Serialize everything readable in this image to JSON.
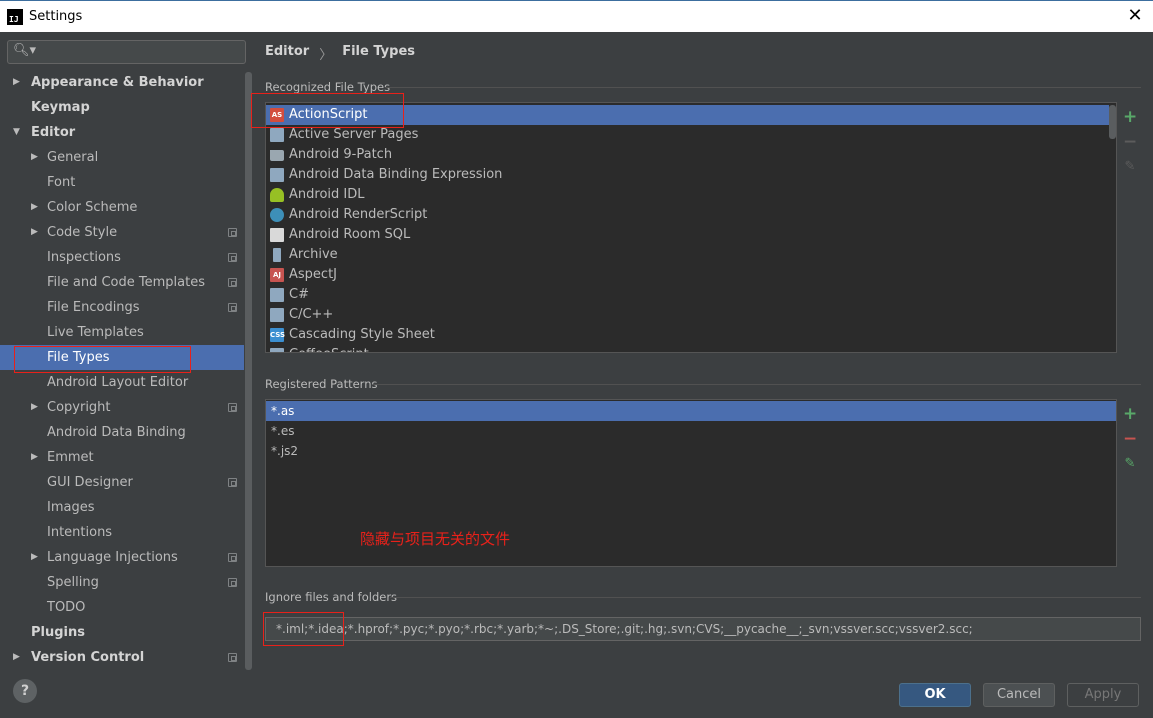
{
  "window": {
    "title": "Settings",
    "app_icon_text": "IJ"
  },
  "search": {
    "placeholder": ""
  },
  "sidebar": {
    "items": [
      {
        "label": "Appearance & Behavior",
        "level": 0,
        "expandable": true,
        "expanded": false,
        "project": false
      },
      {
        "label": "Keymap",
        "level": 0,
        "expandable": false,
        "project": false
      },
      {
        "label": "Editor",
        "level": 0,
        "expandable": true,
        "expanded": true,
        "project": false
      },
      {
        "label": "General",
        "level": 1,
        "expandable": true,
        "expanded": false,
        "project": false
      },
      {
        "label": "Font",
        "level": 1,
        "expandable": false,
        "project": false
      },
      {
        "label": "Color Scheme",
        "level": 1,
        "expandable": true,
        "expanded": false,
        "project": false
      },
      {
        "label": "Code Style",
        "level": 1,
        "expandable": true,
        "expanded": false,
        "project": true
      },
      {
        "label": "Inspections",
        "level": 1,
        "expandable": false,
        "project": true
      },
      {
        "label": "File and Code Templates",
        "level": 1,
        "expandable": false,
        "project": true
      },
      {
        "label": "File Encodings",
        "level": 1,
        "expandable": false,
        "project": true
      },
      {
        "label": "Live Templates",
        "level": 1,
        "expandable": false,
        "project": false
      },
      {
        "label": "File Types",
        "level": 1,
        "expandable": false,
        "project": false,
        "selected": true
      },
      {
        "label": "Android Layout Editor",
        "level": 1,
        "expandable": false,
        "project": false
      },
      {
        "label": "Copyright",
        "level": 1,
        "expandable": true,
        "expanded": false,
        "project": true
      },
      {
        "label": "Android Data Binding",
        "level": 1,
        "expandable": false,
        "project": false
      },
      {
        "label": "Emmet",
        "level": 1,
        "expandable": true,
        "expanded": false,
        "project": false
      },
      {
        "label": "GUI Designer",
        "level": 1,
        "expandable": false,
        "project": true
      },
      {
        "label": "Images",
        "level": 1,
        "expandable": false,
        "project": false
      },
      {
        "label": "Intentions",
        "level": 1,
        "expandable": false,
        "project": false
      },
      {
        "label": "Language Injections",
        "level": 1,
        "expandable": true,
        "expanded": false,
        "project": true
      },
      {
        "label": "Spelling",
        "level": 1,
        "expandable": false,
        "project": true
      },
      {
        "label": "TODO",
        "level": 1,
        "expandable": false,
        "project": false
      },
      {
        "label": "Plugins",
        "level": 0,
        "expandable": false,
        "project": false
      },
      {
        "label": "Version Control",
        "level": 0,
        "expandable": true,
        "expanded": false,
        "project": true
      }
    ]
  },
  "main": {
    "breadcrumb": {
      "parent": "Editor",
      "separator": "〉",
      "current": "File Types"
    },
    "recognized": {
      "title": "Recognized File Types",
      "items": [
        {
          "label": "ActionScript",
          "icon": "actionscript-icon",
          "icon_class": "ic-as",
          "icon_text": "AS",
          "selected": true
        },
        {
          "label": "Active Server Pages",
          "icon": "document-icon",
          "icon_class": "ic-doc",
          "icon_text": ""
        },
        {
          "label": "Android 9-Patch",
          "icon": "folder-icon",
          "icon_class": "ic-folder",
          "icon_text": ""
        },
        {
          "label": "Android Data Binding Expression",
          "icon": "document-icon",
          "icon_class": "ic-doc",
          "icon_text": ""
        },
        {
          "label": "Android IDL",
          "icon": "android-icon",
          "icon_class": "ic-android",
          "icon_text": ""
        },
        {
          "label": "Android RenderScript",
          "icon": "renderscript-icon",
          "icon_class": "ic-rs",
          "icon_text": ""
        },
        {
          "label": "Android Room SQL",
          "icon": "sql-icon",
          "icon_class": "ic-sql",
          "icon_text": ""
        },
        {
          "label": "Archive",
          "icon": "archive-icon",
          "icon_class": "ic-archive",
          "icon_text": ""
        },
        {
          "label": "AspectJ",
          "icon": "aspectj-icon",
          "icon_class": "ic-aspect",
          "icon_text": "AJ"
        },
        {
          "label": "C#",
          "icon": "document-icon",
          "icon_class": "ic-doc",
          "icon_text": ""
        },
        {
          "label": "C/C++",
          "icon": "document-icon",
          "icon_class": "ic-doc",
          "icon_text": ""
        },
        {
          "label": "Cascading Style Sheet",
          "icon": "css-icon",
          "icon_class": "ic-css",
          "icon_text": "CSS"
        },
        {
          "label": "CoffeeScript",
          "icon": "document-icon",
          "icon_class": "ic-doc",
          "icon_text": ""
        }
      ]
    },
    "patterns": {
      "title": "Registered Patterns",
      "items": [
        {
          "label": "*.as",
          "selected": true
        },
        {
          "label": "*.es",
          "selected": false
        },
        {
          "label": "*.js2",
          "selected": false
        }
      ]
    },
    "annotation": "隐藏与项目无关的文件",
    "ignore": {
      "title": "Ignore files and folders",
      "value": "*.iml;*.idea;*.hprof;*.pyc;*.pyo;*.rbc;*.yarb;*~;.DS_Store;.git;.hg;.svn;CVS;__pycache__;_svn;vssver.scc;vssver2.scc;"
    }
  },
  "buttons": {
    "help": "?",
    "ok": "OK",
    "cancel": "Cancel",
    "apply": "Apply"
  },
  "colors": {
    "selection": "#4b6eaf",
    "annotation": "#e8211a",
    "add": "#59a869",
    "remove": "#c75450"
  }
}
